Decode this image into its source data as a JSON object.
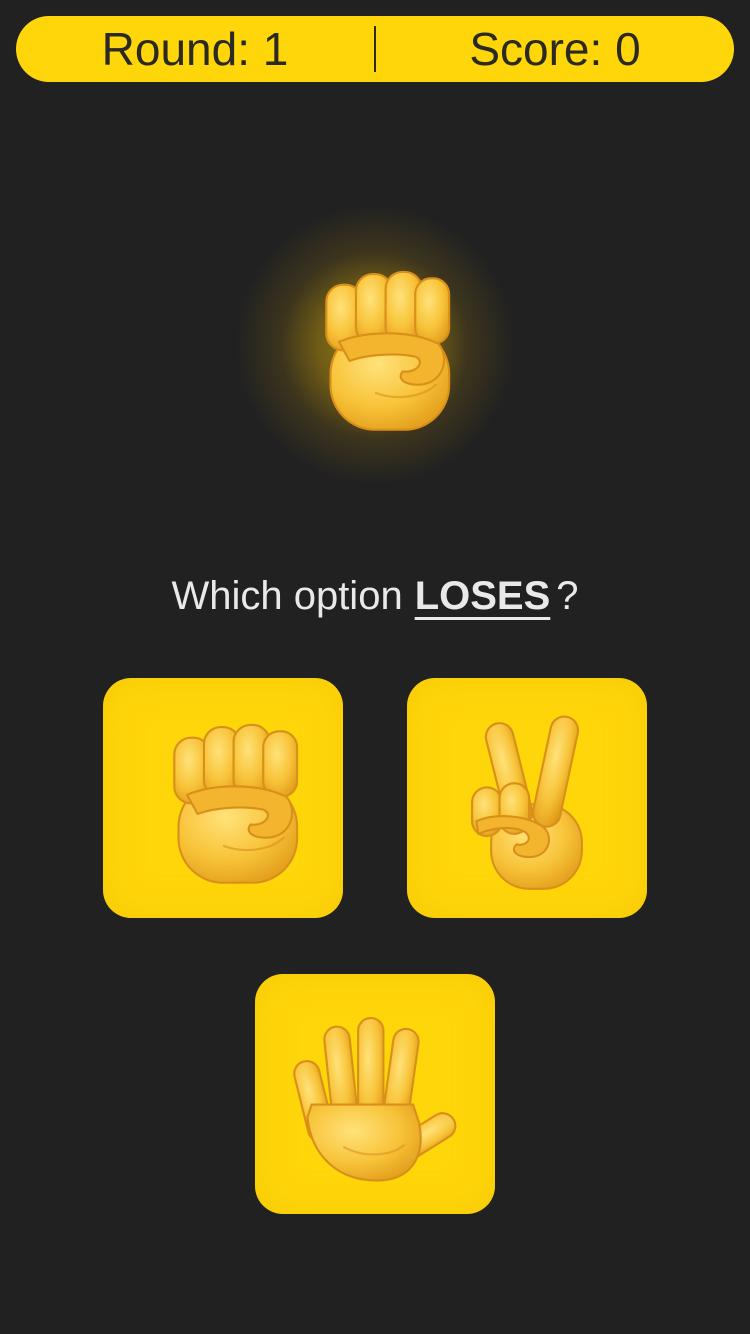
{
  "header": {
    "round_label": "Round:",
    "round_value": "1",
    "score_label": "Score:",
    "score_value": "0"
  },
  "computer_choice": {
    "icon": "raised-fist-icon"
  },
  "prompt": {
    "prefix": "Which option",
    "keyword": "LOSES",
    "suffix": "?"
  },
  "options": [
    {
      "icon": "raised-fist-icon"
    },
    {
      "icon": "victory-hand-icon"
    },
    {
      "icon": "raised-hand-icon"
    }
  ],
  "colors": {
    "accent": "#FFD60A",
    "background": "#212121",
    "skin": "#F8C43A",
    "skin_shade": "#E09A18"
  }
}
